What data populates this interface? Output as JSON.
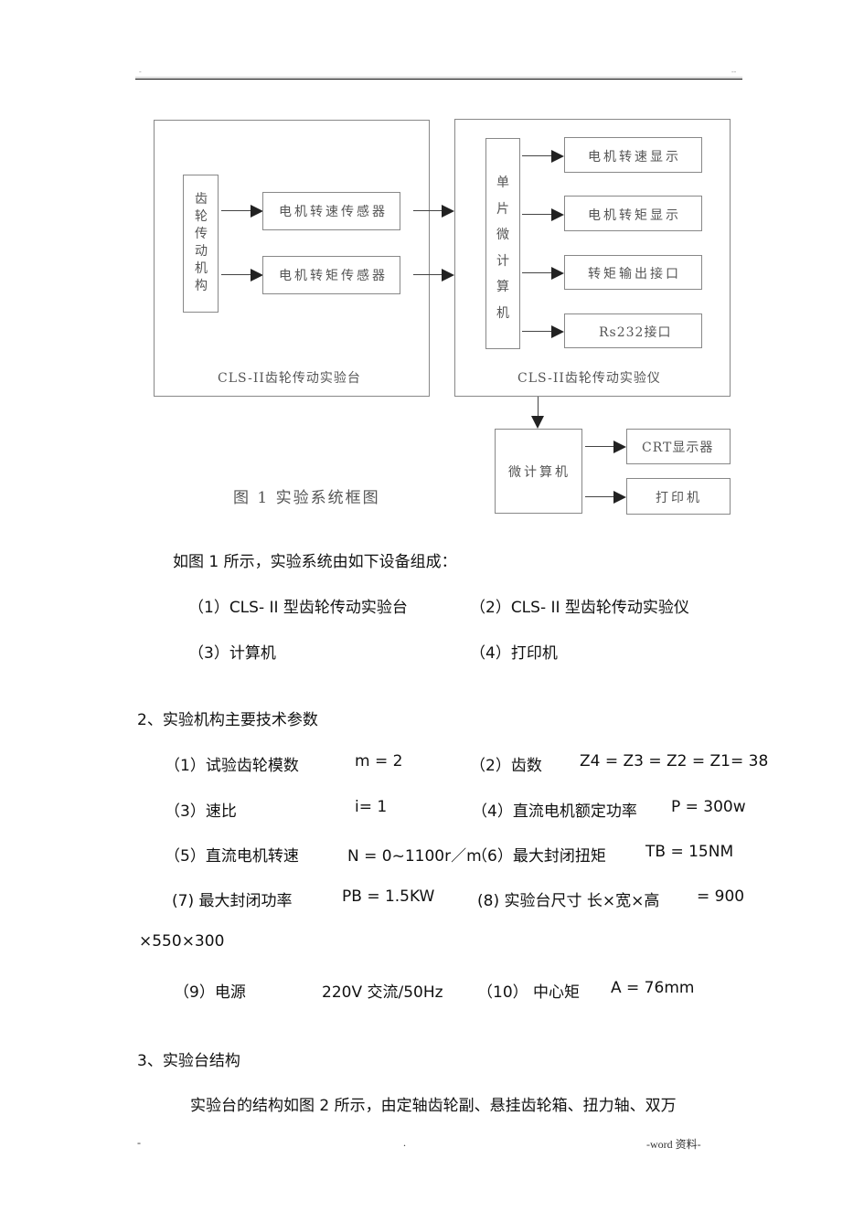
{
  "header": {
    "left_mark": "-",
    "right_mark": "--"
  },
  "diagram": {
    "left_panel": {
      "title": "CLS-II齿轮传动实验台",
      "source_box": [
        "齿",
        "轮",
        "传",
        "动",
        "机",
        "构"
      ],
      "sensors": [
        "电机转速传感器",
        "电机转矩传感器"
      ]
    },
    "right_panel": {
      "title": "CLS-II齿轮传动实验仪",
      "mcu_box": [
        "单",
        "片",
        "微",
        "计",
        "算",
        "机"
      ],
      "outputs": [
        "电机转速显示",
        "电机转矩显示",
        "转矩输出接口",
        "Rs232接口"
      ]
    },
    "computer": {
      "label": "微计算机",
      "outputs": [
        "CRT显示器",
        "打印机"
      ]
    },
    "caption": "图 1 实验系统框图"
  },
  "body": {
    "intro": "如图 1 所示，实验系统由如下设备组成：",
    "devices": [
      "（1）CLS- II 型齿轮传动实验台",
      "（2）CLS- II 型齿轮传动实验仪",
      "（3）计算机",
      "（4）打印机"
    ],
    "section2_title": "2、实验机构主要技术参数",
    "params": [
      {
        "label": "（1）试验齿轮模数",
        "value": "m = 2"
      },
      {
        "label": "（2）齿数",
        "value": "Z4 = Z3 = Z2 = Z1= 38"
      },
      {
        "label": "（3）速比",
        "value": "i= 1"
      },
      {
        "label": "（4）直流电机额定功率",
        "value": "P = 300w"
      },
      {
        "label": "（5）直流电机转速",
        "value": "N = 0~1100r／m"
      },
      {
        "label": "（6）最大封闭扭矩",
        "value": "TB = 15NM"
      },
      {
        "label": "(7) 最大封闭功率",
        "value": "PB = 1.5KW"
      },
      {
        "label": "(8) 实验台尺寸  长×宽×高",
        "value": "= 900"
      },
      {
        "label": "",
        "value": "×550×300"
      },
      {
        "label": "（9）电源",
        "value": "220V 交流/50Hz"
      },
      {
        "label": "（10）  中心矩",
        "value": "A = 76mm"
      }
    ],
    "section3_title": "3、实验台结构",
    "section3_text": "实验台的结构如图 2 所示，由定轴齿轮副、悬挂齿轮箱、扭力轴、双万"
  },
  "footer": {
    "left": "-",
    "center": ".",
    "right": "-word 资料-"
  }
}
